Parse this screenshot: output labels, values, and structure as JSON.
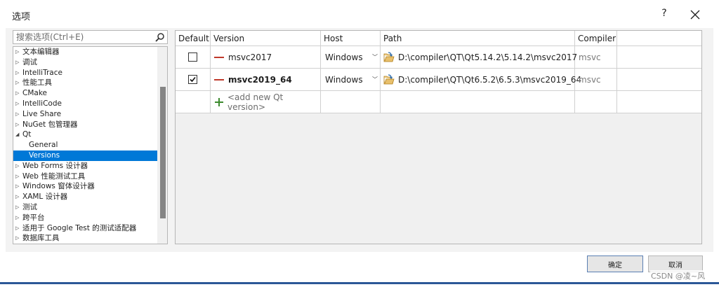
{
  "window": {
    "title": "选项",
    "help_label": "?"
  },
  "search": {
    "placeholder": "搜索选项(Ctrl+E)"
  },
  "tree": {
    "items": [
      {
        "label": "文本编辑器",
        "arrow": "▷"
      },
      {
        "label": "调试",
        "arrow": "▷"
      },
      {
        "label": "IntelliTrace",
        "arrow": "▷"
      },
      {
        "label": "性能工具",
        "arrow": "▷"
      },
      {
        "label": "CMake",
        "arrow": "▷"
      },
      {
        "label": "IntelliCode",
        "arrow": "▷"
      },
      {
        "label": "Live Share",
        "arrow": "▷"
      },
      {
        "label": "NuGet 包管理器",
        "arrow": "▷"
      },
      {
        "label": "Qt",
        "arrow": "◢"
      },
      {
        "label": "General",
        "arrow": ""
      },
      {
        "label": "Versions",
        "arrow": ""
      },
      {
        "label": "Web Forms 设计器",
        "arrow": "▷"
      },
      {
        "label": "Web 性能测试工具",
        "arrow": "▷"
      },
      {
        "label": "Windows 窗体设计器",
        "arrow": "▷"
      },
      {
        "label": "XAML 设计器",
        "arrow": "▷"
      },
      {
        "label": "测试",
        "arrow": "▷"
      },
      {
        "label": "跨平台",
        "arrow": "▷"
      },
      {
        "label": "适用于 Google Test 的测试适配器",
        "arrow": "▷"
      },
      {
        "label": "数据库工具",
        "arrow": "▷"
      }
    ],
    "selected": "Versions"
  },
  "grid": {
    "headers": {
      "default": "Default",
      "version": "Version",
      "host": "Host",
      "path": "Path",
      "compiler": "Compiler"
    },
    "rows": [
      {
        "default": false,
        "version": "msvc2017",
        "host": "Windows",
        "path": "D:\\compiler\\QT\\Qt5.14.2\\5.14.2\\msvc2017",
        "compiler": "msvc"
      },
      {
        "default": true,
        "version": "msvc2019_64",
        "host": "Windows",
        "path": "D:\\compiler\\QT\\Qt6.5.2\\6.5.3\\msvc2019_64",
        "compiler": "msvc"
      }
    ],
    "add_label": "<add new Qt version>"
  },
  "footer": {
    "ok_label": "确定",
    "cancel_label": "取消"
  },
  "watermark": "CSDN @凌~风",
  "colors": {
    "selection": "#0078d7",
    "version_marker": "#c0392b",
    "add_icon": "#3c8a2e"
  }
}
